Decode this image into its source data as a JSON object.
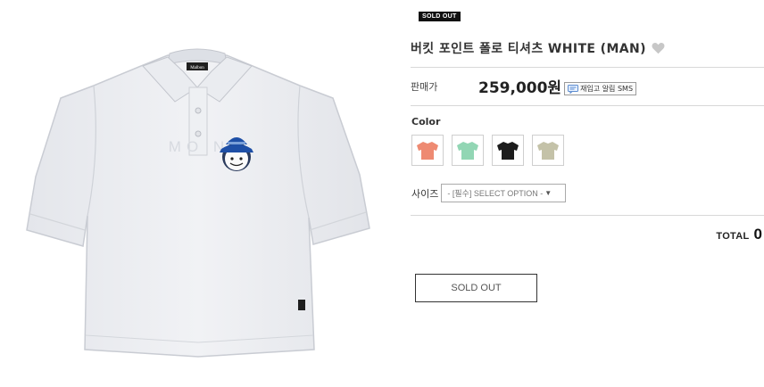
{
  "product": {
    "badge": "SOLD OUT",
    "title": "버킷 포인트 폴로 티셔츠 WHITE (MAN)",
    "price_label": "판매가",
    "price": "259,000원",
    "restock_label": "재입고 알림 SMS",
    "color_label": "Color",
    "colors": [
      {
        "name": "coral",
        "hex": "#ee8a72"
      },
      {
        "name": "mint",
        "hex": "#92d6b4"
      },
      {
        "name": "black",
        "hex": "#1c1c1c"
      },
      {
        "name": "beige",
        "hex": "#c4c2a8"
      }
    ],
    "size_label": "사이즈",
    "size_select": "- [필수] SELECT OPTION -",
    "total_label": "TOTAL",
    "total_value": "0",
    "soldout_button": "SOLD OUT"
  },
  "shirt": {
    "body_color": "#eceef2",
    "brand_tag": "Malbon",
    "chest_text": "MO      N"
  }
}
